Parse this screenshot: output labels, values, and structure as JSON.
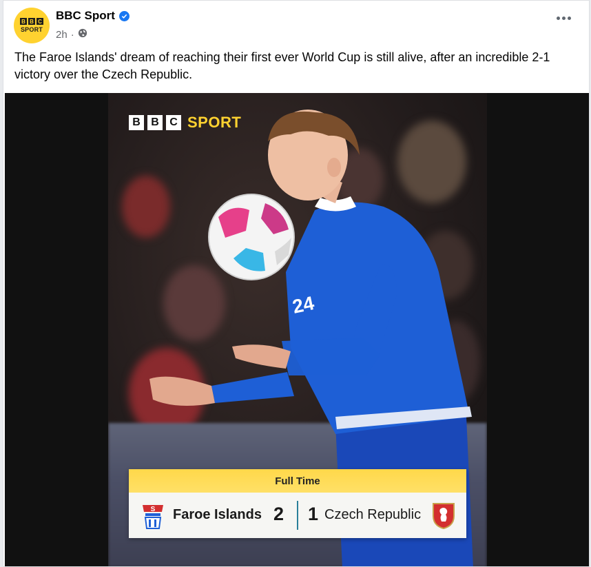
{
  "post": {
    "page_name": "BBC Sport",
    "time": "2h",
    "time_separator": "·",
    "avatar": {
      "blocks": [
        "B",
        "B",
        "C"
      ],
      "text": "SPORT"
    },
    "icons": [
      "verified-badge-icon",
      "globe-icon",
      "more-options-icon"
    ],
    "caption": "The Faroe Islands' dream of reaching their first ever World Cup is still alive, after an incredible 2-1 victory over the Czech Republic."
  },
  "media": {
    "logo": {
      "blocks": [
        "B",
        "B",
        "C"
      ],
      "word": "SPORT"
    },
    "shirt_number": "24",
    "scoreboard": {
      "status": "Full Time",
      "home_team": "Faroe Islands",
      "home_score": "2",
      "away_score": "1",
      "away_team": "Czech Republic"
    }
  },
  "colors": {
    "brand_yellow": "#ffd230",
    "verified_blue": "#1877f2",
    "kit_blue": "#1e5fd6"
  }
}
